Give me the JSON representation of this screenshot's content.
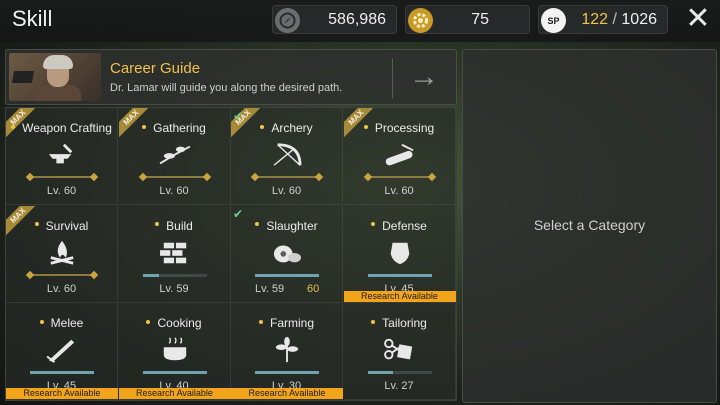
{
  "header": {
    "title": "Skill",
    "resources": [
      {
        "icon": "compass-coin-icon",
        "value": "586,986"
      },
      {
        "icon": "gear-token-icon",
        "value": "75"
      }
    ],
    "sp": {
      "icon": "sp-icon",
      "label": "SP",
      "current": "122",
      "separator": "/",
      "max": "1026"
    },
    "close_label": "✕"
  },
  "career_guide": {
    "title": "Career Guide",
    "subtitle": "Dr. Lamar will guide you along the desired path.",
    "arrow": "→"
  },
  "skills": [
    {
      "name": "Weapon Crafting",
      "level": "Lv. 60",
      "badge": "MAX",
      "progress": 1.0,
      "icon": "anvil-hammer-icon"
    },
    {
      "name": "Gathering",
      "level": "Lv. 60",
      "badge": "MAX",
      "progress": 1.0,
      "icon": "leaf-branch-icon"
    },
    {
      "name": "Archery",
      "level": "Lv. 60",
      "badge": "MAX",
      "check": true,
      "progress": 1.0,
      "icon": "bow-icon"
    },
    {
      "name": "Processing",
      "level": "Lv. 60",
      "badge": "MAX",
      "progress": 1.0,
      "icon": "log-saw-icon"
    },
    {
      "name": "Survival",
      "level": "Lv. 60",
      "badge": "MAX",
      "progress": 1.0,
      "icon": "campfire-icon"
    },
    {
      "name": "Build",
      "level": "Lv. 59",
      "progress": 0.25,
      "icon": "bricks-icon"
    },
    {
      "name": "Slaughter",
      "level": "Lv. 59",
      "next_level": "60",
      "check": true,
      "progress": 1.0,
      "icon": "meat-icon"
    },
    {
      "name": "Defense",
      "level": "Lv. 45",
      "research": "Research Available",
      "progress": 1.0,
      "icon": "shield-icon"
    },
    {
      "name": "Melee",
      "level": "Lv. 45",
      "research": "Research Available",
      "progress": 1.0,
      "icon": "blade-icon"
    },
    {
      "name": "Cooking",
      "level": "Lv. 40",
      "research": "Research Available",
      "progress": 1.0,
      "icon": "cooking-pot-icon"
    },
    {
      "name": "Farming",
      "level": "Lv. 30",
      "research": "Research Available",
      "progress": 1.0,
      "icon": "sprout-icon"
    },
    {
      "name": "Tailoring",
      "level": "Lv. 27",
      "progress": 0.4,
      "icon": "scissors-cloth-icon"
    }
  ],
  "detail_panel": {
    "message": "Select a Category"
  },
  "colors": {
    "accent_gold": "#f0c24a",
    "research_orange": "#f2a41a",
    "progress_teal": "#6fa3ae",
    "max_ribbon": "#a78a38"
  }
}
